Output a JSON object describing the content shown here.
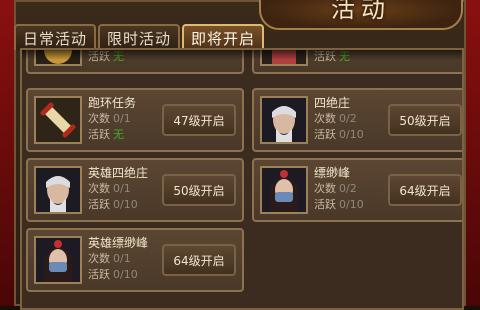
{
  "window": {
    "title": "活动"
  },
  "tabs": [
    {
      "label": "日常活动",
      "active": false
    },
    {
      "label": "限时活动",
      "active": false
    },
    {
      "label": "即将开启",
      "active": true
    }
  ],
  "labels": {
    "count": "次数",
    "activity": "活跃"
  },
  "cards": [
    {
      "id": "top-left-partial",
      "name": "",
      "count_value": "",
      "activity_value": "无"
    },
    {
      "id": "top-right-partial",
      "name": "",
      "count_value": "",
      "activity_value": "无"
    },
    {
      "id": "paohuan",
      "name": "跑环任务",
      "count_value": "0/1",
      "activity_value": "无",
      "open_label": "47级开启",
      "portrait": "scroll-icon"
    },
    {
      "id": "sijuezhuang",
      "name": "四绝庄",
      "count_value": "0/2",
      "activity_value": "0/10",
      "open_label": "50级开启",
      "portrait": "old-man-portrait"
    },
    {
      "id": "yingxiong-sijuezhuang",
      "name": "英雄四绝庄",
      "count_value": "0/1",
      "activity_value": "0/10",
      "open_label": "50级开启",
      "portrait": "old-man-portrait"
    },
    {
      "id": "piaomiaofeng",
      "name": "缥缈峰",
      "count_value": "0/2",
      "activity_value": "0/10",
      "open_label": "64级开启",
      "portrait": "masked-woman-portrait"
    },
    {
      "id": "yingxiong-piaomiaofeng",
      "name": "英雄缥缈峰",
      "count_value": "0/1",
      "activity_value": "0/10",
      "open_label": "64级开启",
      "portrait": "masked-woman-portrait"
    }
  ],
  "colors": {
    "green": "#3fae2a",
    "gray": "#8e8878",
    "accent": "#e0b870"
  }
}
